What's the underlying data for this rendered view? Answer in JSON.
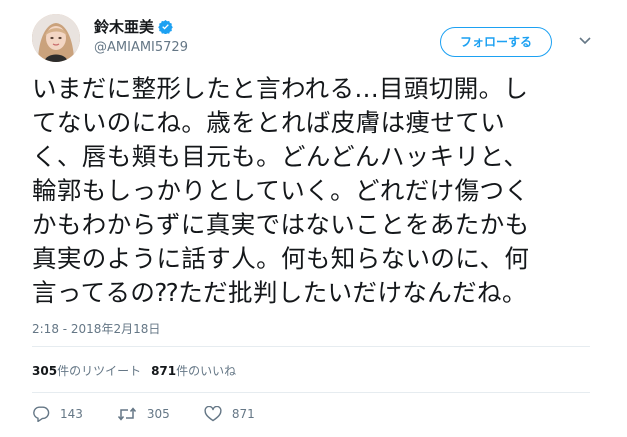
{
  "user": {
    "display_name": "鈴木亜美",
    "handle": "@AMIAMI5729"
  },
  "follow_button_label": "フォローする",
  "tweet": {
    "lines": [
      "いまだに整形したと言われる...目頭切開。し",
      "てないのにね。歳をとれば皮膚は痩せてい",
      "く、唇も頬も目元も。どんどんハッキリと、",
      "輪郭もしっかりとしていく。どれだけ傷つく",
      "かもわからずに真実ではないことをあたかも",
      "真実のように話す人。何も知らないのに、何",
      "言ってるの⁇ただ批判したいだけなんだね。"
    ],
    "timestamp": "2:18 - 2018年2月18日"
  },
  "stats": {
    "retweets_count": "305",
    "retweets_label": "件のリツイート",
    "likes_count": "871",
    "likes_label": "件のいいね"
  },
  "actions": {
    "reply_count": "143",
    "retweet_count": "305",
    "like_count": "871"
  },
  "icons": {
    "verified": "verified-badge-icon",
    "caret": "chevron-down-icon",
    "reply": "reply-icon",
    "retweet": "retweet-icon",
    "like": "heart-icon"
  },
  "colors": {
    "accent": "#1da1f2",
    "text": "#14171a",
    "muted": "#657786",
    "divider": "#e6ecf0"
  }
}
